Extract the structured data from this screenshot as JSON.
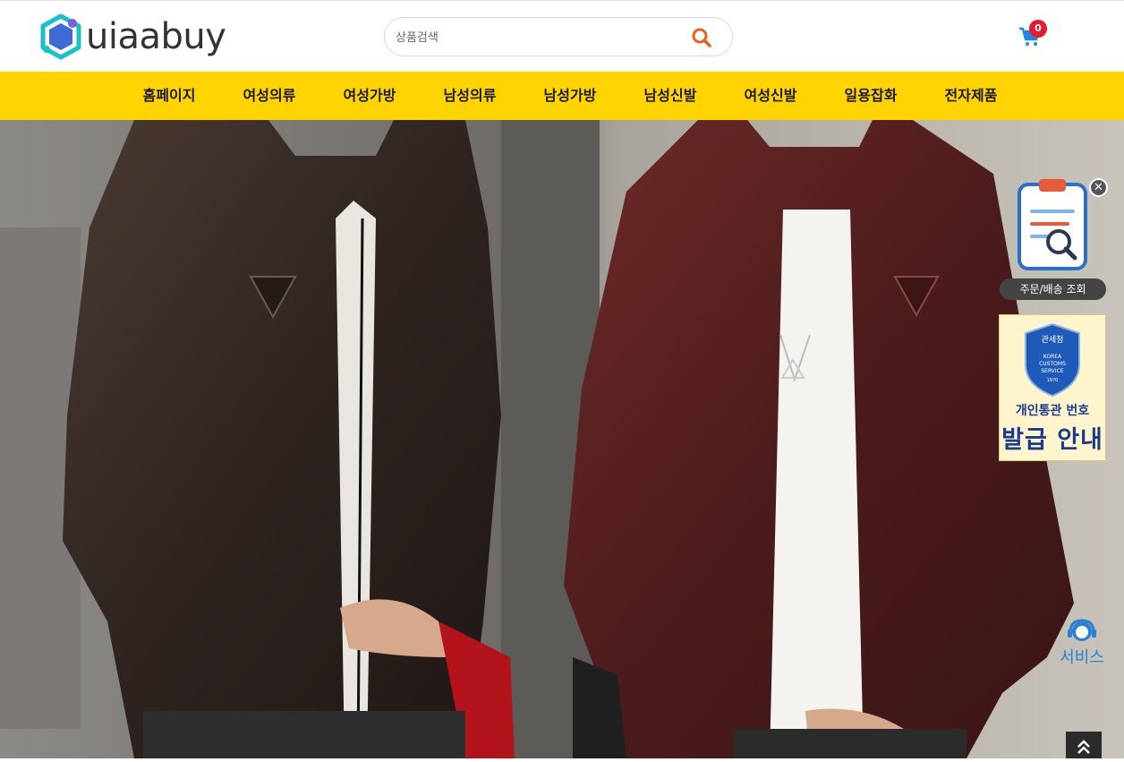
{
  "header": {
    "logo_text": "uiaabuy",
    "search": {
      "placeholder": "상품검색",
      "value": ""
    },
    "cart": {
      "count": "0"
    }
  },
  "nav": {
    "items": [
      {
        "label": "홈페이지"
      },
      {
        "label": "여성의류"
      },
      {
        "label": "여성가방"
      },
      {
        "label": "남성의류"
      },
      {
        "label": "남성가방"
      },
      {
        "label": "남성신발"
      },
      {
        "label": "여성신발"
      },
      {
        "label": "일용잡화"
      },
      {
        "label": "전자제품"
      }
    ]
  },
  "side": {
    "order_label": "주문/배송 조회",
    "customs": {
      "badge_top": "관세청",
      "badge_mid": "KOREA CUSTOMS SERVICE",
      "badge_year": "1970",
      "line1": "개인통관 번호",
      "line2": "발급 안내"
    },
    "service_label": "서비스"
  },
  "colors": {
    "nav_bg": "#ffd400",
    "search_icon": "#e8631c",
    "cart_icon": "#1e88e5",
    "badge": "#e8192c",
    "service": "#2a7fd6"
  }
}
